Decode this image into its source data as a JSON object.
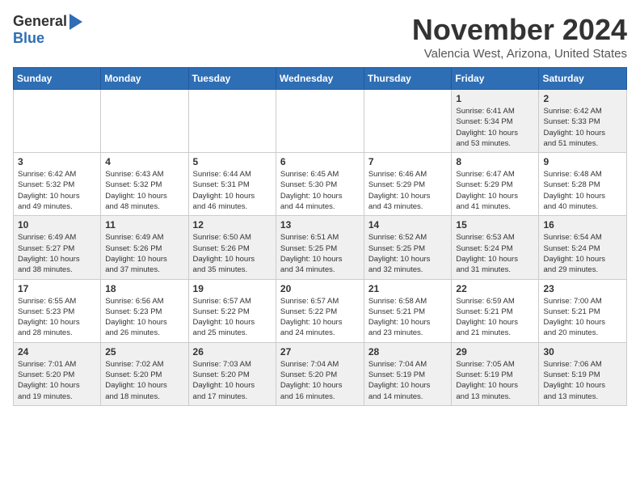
{
  "header": {
    "logo_general": "General",
    "logo_blue": "Blue",
    "month_title": "November 2024",
    "location": "Valencia West, Arizona, United States"
  },
  "calendar": {
    "days_of_week": [
      "Sunday",
      "Monday",
      "Tuesday",
      "Wednesday",
      "Thursday",
      "Friday",
      "Saturday"
    ],
    "weeks": [
      [
        {
          "day": "",
          "info": ""
        },
        {
          "day": "",
          "info": ""
        },
        {
          "day": "",
          "info": ""
        },
        {
          "day": "",
          "info": ""
        },
        {
          "day": "",
          "info": ""
        },
        {
          "day": "1",
          "info": "Sunrise: 6:41 AM\nSunset: 5:34 PM\nDaylight: 10 hours\nand 53 minutes."
        },
        {
          "day": "2",
          "info": "Sunrise: 6:42 AM\nSunset: 5:33 PM\nDaylight: 10 hours\nand 51 minutes."
        }
      ],
      [
        {
          "day": "3",
          "info": "Sunrise: 6:42 AM\nSunset: 5:32 PM\nDaylight: 10 hours\nand 49 minutes."
        },
        {
          "day": "4",
          "info": "Sunrise: 6:43 AM\nSunset: 5:32 PM\nDaylight: 10 hours\nand 48 minutes."
        },
        {
          "day": "5",
          "info": "Sunrise: 6:44 AM\nSunset: 5:31 PM\nDaylight: 10 hours\nand 46 minutes."
        },
        {
          "day": "6",
          "info": "Sunrise: 6:45 AM\nSunset: 5:30 PM\nDaylight: 10 hours\nand 44 minutes."
        },
        {
          "day": "7",
          "info": "Sunrise: 6:46 AM\nSunset: 5:29 PM\nDaylight: 10 hours\nand 43 minutes."
        },
        {
          "day": "8",
          "info": "Sunrise: 6:47 AM\nSunset: 5:29 PM\nDaylight: 10 hours\nand 41 minutes."
        },
        {
          "day": "9",
          "info": "Sunrise: 6:48 AM\nSunset: 5:28 PM\nDaylight: 10 hours\nand 40 minutes."
        }
      ],
      [
        {
          "day": "10",
          "info": "Sunrise: 6:49 AM\nSunset: 5:27 PM\nDaylight: 10 hours\nand 38 minutes."
        },
        {
          "day": "11",
          "info": "Sunrise: 6:49 AM\nSunset: 5:26 PM\nDaylight: 10 hours\nand 37 minutes."
        },
        {
          "day": "12",
          "info": "Sunrise: 6:50 AM\nSunset: 5:26 PM\nDaylight: 10 hours\nand 35 minutes."
        },
        {
          "day": "13",
          "info": "Sunrise: 6:51 AM\nSunset: 5:25 PM\nDaylight: 10 hours\nand 34 minutes."
        },
        {
          "day": "14",
          "info": "Sunrise: 6:52 AM\nSunset: 5:25 PM\nDaylight: 10 hours\nand 32 minutes."
        },
        {
          "day": "15",
          "info": "Sunrise: 6:53 AM\nSunset: 5:24 PM\nDaylight: 10 hours\nand 31 minutes."
        },
        {
          "day": "16",
          "info": "Sunrise: 6:54 AM\nSunset: 5:24 PM\nDaylight: 10 hours\nand 29 minutes."
        }
      ],
      [
        {
          "day": "17",
          "info": "Sunrise: 6:55 AM\nSunset: 5:23 PM\nDaylight: 10 hours\nand 28 minutes."
        },
        {
          "day": "18",
          "info": "Sunrise: 6:56 AM\nSunset: 5:23 PM\nDaylight: 10 hours\nand 26 minutes."
        },
        {
          "day": "19",
          "info": "Sunrise: 6:57 AM\nSunset: 5:22 PM\nDaylight: 10 hours\nand 25 minutes."
        },
        {
          "day": "20",
          "info": "Sunrise: 6:57 AM\nSunset: 5:22 PM\nDaylight: 10 hours\nand 24 minutes."
        },
        {
          "day": "21",
          "info": "Sunrise: 6:58 AM\nSunset: 5:21 PM\nDaylight: 10 hours\nand 23 minutes."
        },
        {
          "day": "22",
          "info": "Sunrise: 6:59 AM\nSunset: 5:21 PM\nDaylight: 10 hours\nand 21 minutes."
        },
        {
          "day": "23",
          "info": "Sunrise: 7:00 AM\nSunset: 5:21 PM\nDaylight: 10 hours\nand 20 minutes."
        }
      ],
      [
        {
          "day": "24",
          "info": "Sunrise: 7:01 AM\nSunset: 5:20 PM\nDaylight: 10 hours\nand 19 minutes."
        },
        {
          "day": "25",
          "info": "Sunrise: 7:02 AM\nSunset: 5:20 PM\nDaylight: 10 hours\nand 18 minutes."
        },
        {
          "day": "26",
          "info": "Sunrise: 7:03 AM\nSunset: 5:20 PM\nDaylight: 10 hours\nand 17 minutes."
        },
        {
          "day": "27",
          "info": "Sunrise: 7:04 AM\nSunset: 5:20 PM\nDaylight: 10 hours\nand 16 minutes."
        },
        {
          "day": "28",
          "info": "Sunrise: 7:04 AM\nSunset: 5:19 PM\nDaylight: 10 hours\nand 14 minutes."
        },
        {
          "day": "29",
          "info": "Sunrise: 7:05 AM\nSunset: 5:19 PM\nDaylight: 10 hours\nand 13 minutes."
        },
        {
          "day": "30",
          "info": "Sunrise: 7:06 AM\nSunset: 5:19 PM\nDaylight: 10 hours\nand 13 minutes."
        }
      ]
    ]
  }
}
